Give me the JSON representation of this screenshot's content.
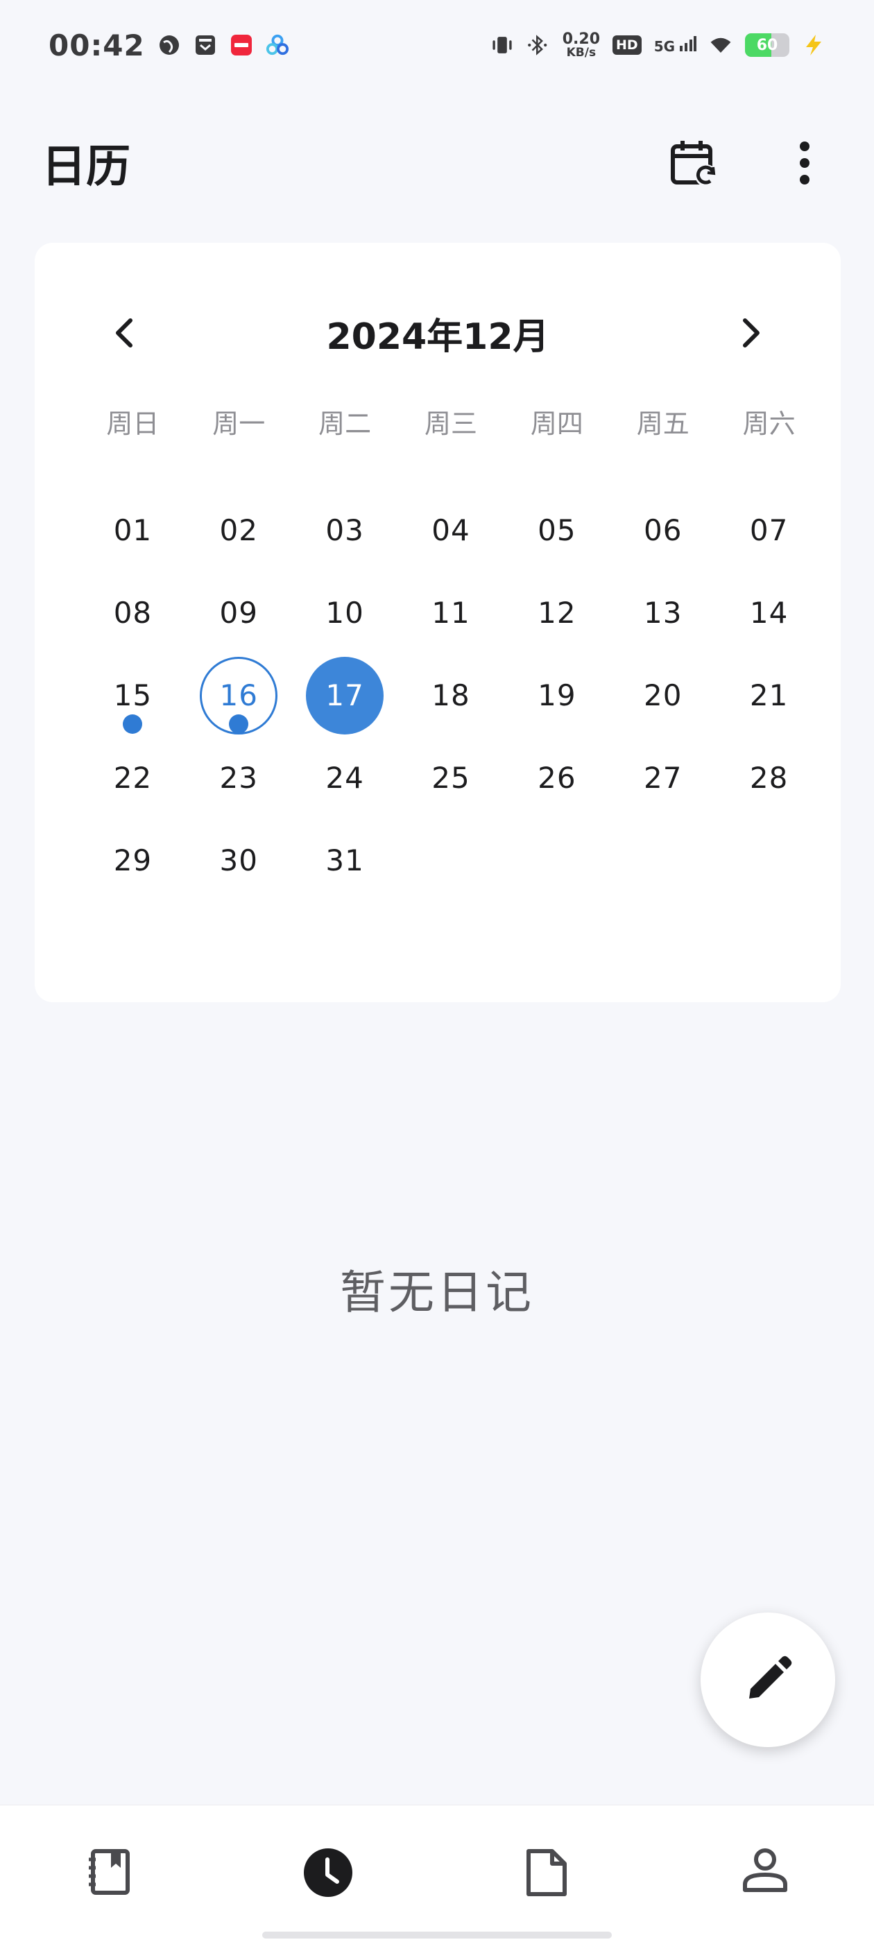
{
  "status_bar": {
    "time": "00:42",
    "net_speed_value": "0.20",
    "net_speed_unit": "KB/s",
    "hd_label": "HD",
    "network_label": "5G",
    "battery_level": "60",
    "battery_fraction": 0.6,
    "colors": {
      "battery": "#4cd964",
      "charge": "#f5c518"
    }
  },
  "header": {
    "title": "日历",
    "icons": [
      "calendar-sync-icon",
      "more-vert-icon"
    ]
  },
  "calendar": {
    "month_label": "2024年12月",
    "weekdays": [
      "周日",
      "周一",
      "周二",
      "周三",
      "周四",
      "周五",
      "周六"
    ],
    "days": [
      "01",
      "02",
      "03",
      "04",
      "05",
      "06",
      "07",
      "08",
      "09",
      "10",
      "11",
      "12",
      "13",
      "14",
      "15",
      "16",
      "17",
      "18",
      "19",
      "20",
      "21",
      "22",
      "23",
      "24",
      "25",
      "26",
      "27",
      "28",
      "29",
      "30",
      "31"
    ],
    "today": "16",
    "selected": "17",
    "days_with_entries": [
      "15",
      "16"
    ],
    "accent_color": "#3d86d9"
  },
  "empty_state": {
    "text": "暂无日记"
  },
  "fab": {
    "icon": "edit-pencil-icon"
  },
  "bottom_nav": {
    "items": [
      {
        "icon": "diary-book-icon",
        "active": false
      },
      {
        "icon": "clock-icon",
        "active": true
      },
      {
        "icon": "document-icon",
        "active": false
      },
      {
        "icon": "person-icon",
        "active": false
      }
    ]
  }
}
